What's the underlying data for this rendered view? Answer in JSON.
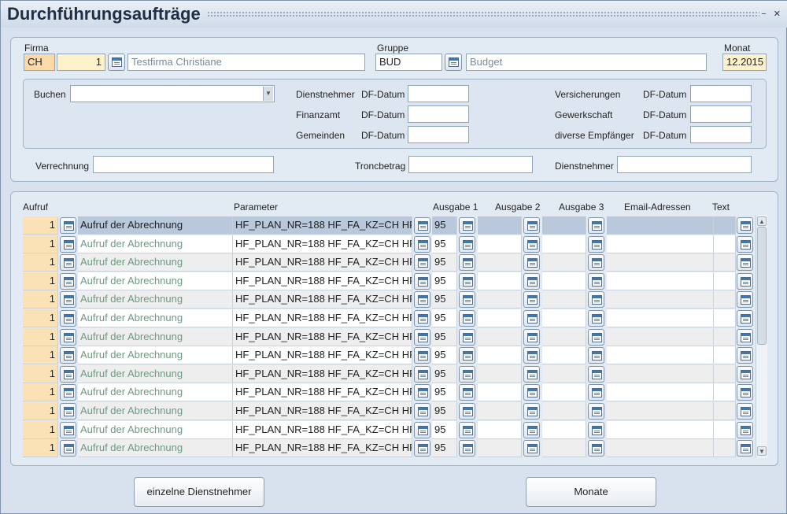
{
  "title": "Durchführungsaufträge",
  "window_buttons": "− ✕",
  "header": {
    "firma_label": "Firma",
    "firma_code": "CH",
    "firma_number": "1",
    "firma_name": "Testfirma Christiane",
    "gruppe_label": "Gruppe",
    "gruppe_code": "BUD",
    "gruppe_name": "Budget",
    "monat_label": "Monat",
    "monat_value": "12.2015"
  },
  "buchen": {
    "buchen_label": "Buchen",
    "buchen_value": "",
    "dienstnehmer_label": "Dienstnehmer",
    "finanzamt_label": "Finanzamt",
    "gemeinden_label": "Gemeinden",
    "versicherungen_label": "Versicherungen",
    "gewerkschaft_label": "Gewerkschaft",
    "diverse_label": "diverse Empfänger",
    "df_datum_label": "DF-Datum"
  },
  "lower": {
    "verrechnung_label": "Verrechnung",
    "troncbetrag_label": "Troncbetrag",
    "dienstnehmer_label": "Dienstnehmer"
  },
  "table": {
    "columns": {
      "aufruf": "Aufruf",
      "parameter": "Parameter",
      "ausgabe1": "Ausgabe 1",
      "ausgabe2": "Ausgabe 2",
      "ausgabe3": "Ausgabe 3",
      "email": "Email-Adressen",
      "text": "Text"
    },
    "rows": [
      {
        "nr": "1",
        "aufruf": "Aufruf der Abrechnung",
        "parameter": "HF_PLAN_NR=188 HF_FA_KZ=CH HF_",
        "ausgabe1": "95"
      },
      {
        "nr": "1",
        "aufruf": "Aufruf der Abrechnung",
        "parameter": "HF_PLAN_NR=188 HF_FA_KZ=CH HF_",
        "ausgabe1": "95"
      },
      {
        "nr": "1",
        "aufruf": "Aufruf der Abrechnung",
        "parameter": "HF_PLAN_NR=188 HF_FA_KZ=CH HF_",
        "ausgabe1": "95"
      },
      {
        "nr": "1",
        "aufruf": "Aufruf der Abrechnung",
        "parameter": "HF_PLAN_NR=188 HF_FA_KZ=CH HF_",
        "ausgabe1": "95"
      },
      {
        "nr": "1",
        "aufruf": "Aufruf der Abrechnung",
        "parameter": "HF_PLAN_NR=188 HF_FA_KZ=CH HF_",
        "ausgabe1": "95"
      },
      {
        "nr": "1",
        "aufruf": "Aufruf der Abrechnung",
        "parameter": "HF_PLAN_NR=188 HF_FA_KZ=CH HF_",
        "ausgabe1": "95"
      },
      {
        "nr": "1",
        "aufruf": "Aufruf der Abrechnung",
        "parameter": "HF_PLAN_NR=188 HF_FA_KZ=CH HF_",
        "ausgabe1": "95"
      },
      {
        "nr": "1",
        "aufruf": "Aufruf der Abrechnung",
        "parameter": "HF_PLAN_NR=188 HF_FA_KZ=CH HF_",
        "ausgabe1": "95"
      },
      {
        "nr": "1",
        "aufruf": "Aufruf der Abrechnung",
        "parameter": "HF_PLAN_NR=188 HF_FA_KZ=CH HF_",
        "ausgabe1": "95"
      },
      {
        "nr": "1",
        "aufruf": "Aufruf der Abrechnung",
        "parameter": "HF_PLAN_NR=188 HF_FA_KZ=CH HF_",
        "ausgabe1": "95"
      },
      {
        "nr": "1",
        "aufruf": "Aufruf der Abrechnung",
        "parameter": "HF_PLAN_NR=188 HF_FA_KZ=CH HF_",
        "ausgabe1": "95"
      },
      {
        "nr": "1",
        "aufruf": "Aufruf der Abrechnung",
        "parameter": "HF_PLAN_NR=188 HF_FA_KZ=CH HF_",
        "ausgabe1": "95"
      },
      {
        "nr": "1",
        "aufruf": "Aufruf der Abrechnung",
        "parameter": "HF_PLAN_NR=188 HF_FA_KZ=CH HF_",
        "ausgabe1": "95"
      }
    ]
  },
  "buttons": {
    "einzelne": "einzelne Dienstnehmer",
    "monate": "Monate"
  },
  "colors": {
    "selected_row": "#b9c8da",
    "nr_cell": "#fbe2b6",
    "aufruf_text": "#6c9a82"
  },
  "icons": {
    "lov": "calendar-list-icon",
    "dropdown": "chevron-down-icon"
  }
}
